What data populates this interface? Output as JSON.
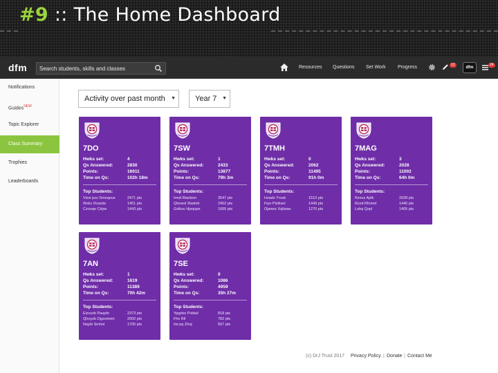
{
  "slide": {
    "number": "#9",
    "title": " :: The Home Dashboard"
  },
  "topbar": {
    "logo": "dfm",
    "search_placeholder": "Search students, skills and classes",
    "nav": [
      "Resources",
      "Questions",
      "Set Work",
      "Progress"
    ],
    "pencil_badge": "12",
    "avatar": "dfm",
    "menu_badge": "24"
  },
  "sidebar": {
    "items": [
      {
        "label": "Notifications"
      },
      {
        "label": "Guides",
        "tag": "NEW"
      },
      {
        "label": "Topic Explorer"
      },
      {
        "label": "Class Summary"
      },
      {
        "label": "Trophies"
      },
      {
        "label": "Leaderboards"
      }
    ],
    "active_index": 3
  },
  "filters": {
    "period": "Activity over past month",
    "year": "Year 7"
  },
  "labels": {
    "hwks": "Hwks set:",
    "qs": "Qs Answered:",
    "points": "Points:",
    "time": "Time on Qs:",
    "top": "Top Students:"
  },
  "cards": [
    {
      "name": "7DO",
      "hwks": "4",
      "qs": "2830",
      "points": "16011",
      "time": "102h 18m",
      "students": [
        {
          "name": "Vixxi pzu Smoqeus",
          "pts": "2471 pts"
        },
        {
          "name": "Wxkc Rzaxdz",
          "pts": "1451 pts"
        },
        {
          "name": "Czooqe Cdyw",
          "pts": "1443 pts"
        }
      ]
    },
    {
      "name": "7SW",
      "hwks": "1",
      "qs": "2433",
      "points": "13877",
      "time": "79h 3m",
      "students": [
        {
          "name": "Irmd Rtanbon",
          "pts": "3547 pts"
        },
        {
          "name": "Qtoned Xlwdnh",
          "pts": "2452 pts"
        },
        {
          "name": "Gxlkuv Hjsqupe",
          "pts": "1065 pts"
        }
      ]
    },
    {
      "name": "7TMH",
      "hwks": "0",
      "qs": "2062",
      "points": "11495",
      "time": "91h 0m",
      "students": [
        {
          "name": "Hzadx Yrosk",
          "pts": "1510 pts"
        },
        {
          "name": "Fiyo Plztlizel",
          "pts": "1449 pts"
        },
        {
          "name": "Ojaxwz Xqliwas",
          "pts": "1270 pts"
        }
      ]
    },
    {
      "name": "7MAG",
      "hwks": "3",
      "qs": "2028",
      "points": "11002",
      "time": "64h 0m",
      "students": [
        {
          "name": "Rzxoz Aplk",
          "pts": "2028 pts"
        },
        {
          "name": "Rzzd Rfomel",
          "pts": "1440 pts"
        },
        {
          "name": "Lobq Qzpl",
          "pts": "1405 pts"
        }
      ]
    },
    {
      "name": "7AN",
      "hwks": "1",
      "qs": "1619",
      "points": "11389",
      "time": "70h 42m",
      "students": [
        {
          "name": "Eizvzzb Paupfo",
          "pts": "2373 pts"
        },
        {
          "name": "Qhoyzb Ogzomnin",
          "pts": "2002 pts"
        },
        {
          "name": "Nejzb Smhol",
          "pts": "1705 pts"
        }
      ]
    },
    {
      "name": "7SE",
      "hwks": "0",
      "qs": "1086",
      "points": "4959",
      "time": "35h 27m",
      "students": [
        {
          "name": "Ypgzbo Pvldwl",
          "pts": "818 pts"
        },
        {
          "name": "Fhx Rll",
          "pts": "782 pts"
        },
        {
          "name": "Iisi pq Zhoj",
          "pts": "567 pts"
        }
      ]
    }
  ],
  "footer": {
    "copyright": "(c) DrJ Trust 2017",
    "links": [
      "Privacy Policy",
      "Donate",
      "Contact Me"
    ]
  },
  "colors": {
    "card": "#6f2da8",
    "sidebar_active": "#8bc53f",
    "title_number": "#9bd33c",
    "topbar": "#2b2b2b"
  }
}
